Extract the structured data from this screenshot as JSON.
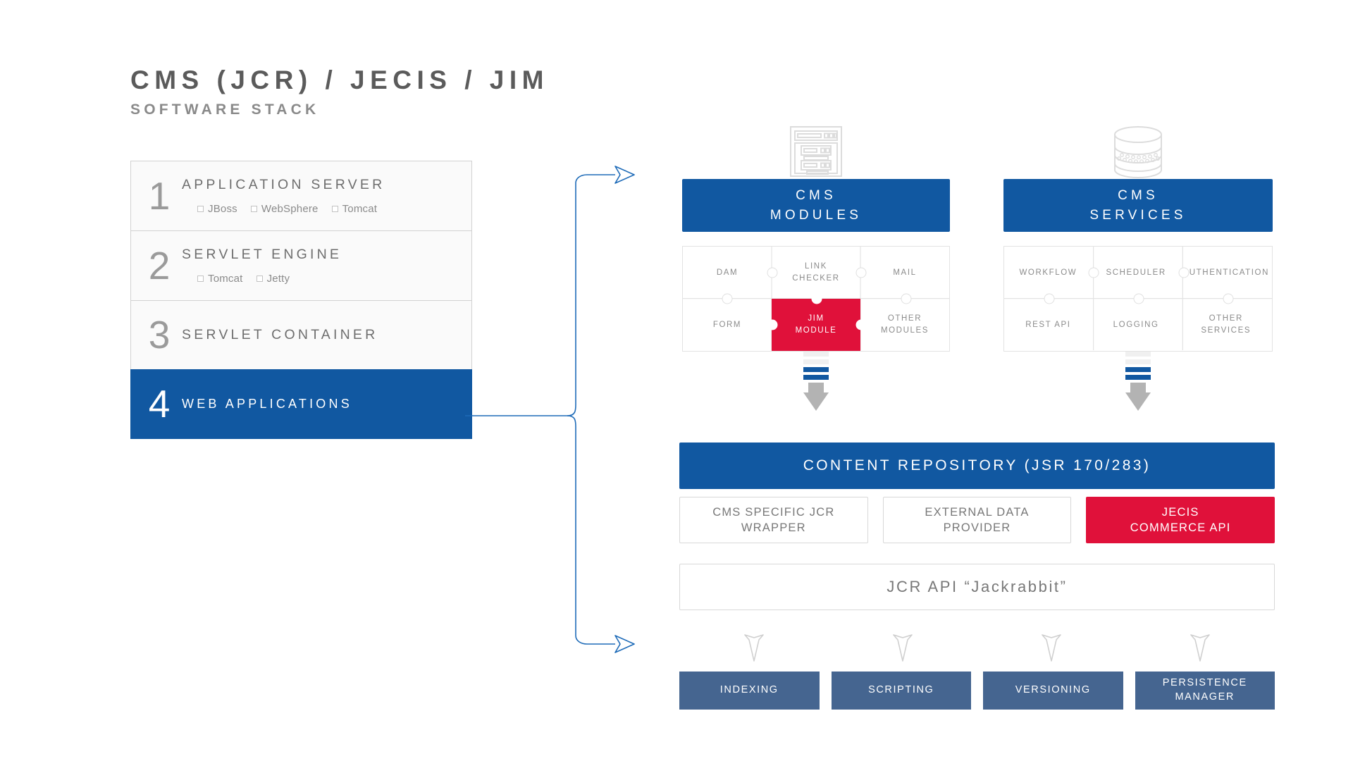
{
  "title": {
    "main": "CMS (JCR) / JECIS / JIM",
    "sub": "SOFTWARE STACK"
  },
  "colors": {
    "blue": "#1158A1",
    "red": "#E0113A",
    "slate": "#456590",
    "gray_text": "#8B8B8B",
    "panel_border": "#E3E3E3"
  },
  "stack": {
    "rows": [
      {
        "number": "1",
        "label": "APPLICATION SERVER",
        "options": [
          "JBoss",
          "WebSphere",
          "Tomcat"
        ]
      },
      {
        "number": "2",
        "label": "SERVLET ENGINE",
        "options": [
          "Tomcat",
          "Jetty"
        ]
      },
      {
        "number": "3",
        "label": "SERVLET CONTAINER",
        "options": []
      },
      {
        "number": "4",
        "label": "WEB APPLICATIONS",
        "options": []
      }
    ]
  },
  "panels": [
    {
      "icon": "server-rack-icon",
      "title_line1": "CMS",
      "title_line2": "MODULES",
      "cells": [
        {
          "label": "DAM",
          "highlight": false
        },
        {
          "label": "LINK\nCHECKER",
          "highlight": false
        },
        {
          "label": "MAIL",
          "highlight": false
        },
        {
          "label": "FORM",
          "highlight": false
        },
        {
          "label": "JIM\nMODULE",
          "highlight": true
        },
        {
          "label": "OTHER\nMODULES",
          "highlight": false
        }
      ]
    },
    {
      "icon": "database-cylinder-icon",
      "title_line1": "CMS",
      "title_line2": "SERVICES",
      "cells": [
        {
          "label": "WORKFLOW",
          "highlight": false
        },
        {
          "label": "SCHEDULER",
          "highlight": false
        },
        {
          "label": "AUTHENTICATION",
          "highlight": false
        },
        {
          "label": "REST API",
          "highlight": false
        },
        {
          "label": "LOGGING",
          "highlight": false
        },
        {
          "label": "OTHER\nSERVICES",
          "highlight": false
        }
      ]
    }
  ],
  "repository": {
    "bar_label": "CONTENT REPOSITORY (JSR 170/283)",
    "boxes": [
      {
        "label": "CMS SPECIFIC JCR\nWRAPPER",
        "highlight": false
      },
      {
        "label": "EXTERNAL DATA\nPROVIDER",
        "highlight": false
      },
      {
        "label": "JECIS\nCOMMERCE API",
        "highlight": true
      }
    ],
    "jcr_api_label": "JCR API “Jackrabbit”"
  },
  "bottom": {
    "boxes": [
      {
        "label": "INDEXING"
      },
      {
        "label": "SCRIPTING"
      },
      {
        "label": "VERSIONING"
      },
      {
        "label": "PERSISTENCE\nMANAGER"
      }
    ]
  }
}
